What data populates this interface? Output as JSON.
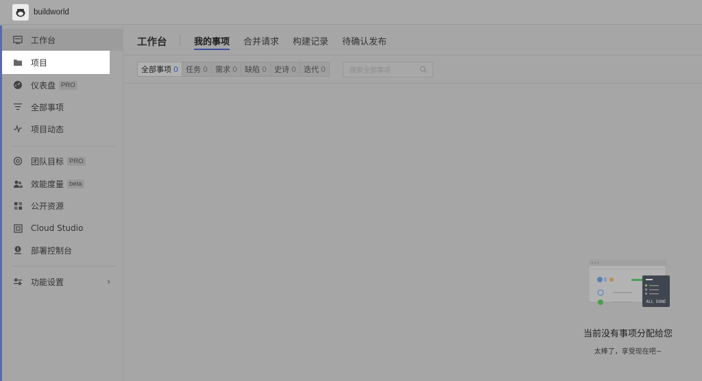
{
  "team": {
    "name": "buildworld"
  },
  "sidebar": {
    "items": [
      {
        "label": "工作台",
        "icon": "workbench-icon"
      },
      {
        "label": "项目",
        "icon": "folder-icon"
      },
      {
        "label": "仪表盘",
        "icon": "dashboard-icon",
        "badge": "PRO"
      },
      {
        "label": "全部事项",
        "icon": "filter-list-icon"
      },
      {
        "label": "项目动态",
        "icon": "activity-icon"
      },
      {
        "label": "团队目标",
        "icon": "target-icon",
        "badge": "PRO"
      },
      {
        "label": "效能度量",
        "icon": "people-icon",
        "badge": "beta"
      },
      {
        "label": "公开资源",
        "icon": "grid-icon"
      },
      {
        "label": "Cloud Studio",
        "icon": "cloud-studio-icon"
      },
      {
        "label": "部署控制台",
        "icon": "deploy-icon"
      },
      {
        "label": "功能设置",
        "icon": "settings-sliders-icon"
      }
    ],
    "active_index": 0,
    "highlight_index": 1
  },
  "header": {
    "title": "工作台",
    "tabs": [
      "我的事项",
      "合并请求",
      "构建记录",
      "待确认发布"
    ],
    "active_tab": 0
  },
  "filters": {
    "segments": [
      {
        "label": "全部事项",
        "count": "0"
      },
      {
        "label": "任务",
        "count": "0"
      },
      {
        "label": "需求",
        "count": "0"
      },
      {
        "label": "缺陷",
        "count": "0"
      },
      {
        "label": "史诗",
        "count": "0"
      },
      {
        "label": "迭代",
        "count": "0"
      }
    ],
    "search_placeholder": "搜索全部事项"
  },
  "empty_state": {
    "title": "当前没有事项分配给您",
    "subtitle": "太棒了，享受现在吧~",
    "illustration_text": "ALL DONE"
  },
  "colors": {
    "accent": "#3d4f9e",
    "overlay": "#a6a6a6",
    "highlight": "#ffffff"
  }
}
